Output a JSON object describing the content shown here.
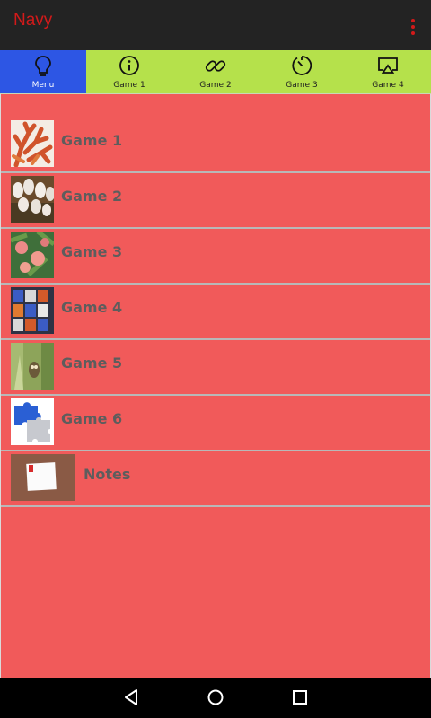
{
  "app": {
    "title": "Navy"
  },
  "tabs": [
    {
      "label": "Menu",
      "icon": "lightbulb-icon",
      "active": true
    },
    {
      "label": "Game 1",
      "icon": "info-icon",
      "active": false
    },
    {
      "label": "Game 2",
      "icon": "link-icon",
      "active": false
    },
    {
      "label": "Game 3",
      "icon": "timer-icon",
      "active": false
    },
    {
      "label": "Game 4",
      "icon": "cast-icon",
      "active": false
    }
  ],
  "list": [
    {
      "label": "Game 1",
      "thumb": "coral-photo"
    },
    {
      "label": "Game 2",
      "thumb": "flowers-photo"
    },
    {
      "label": "Game 3",
      "thumb": "peaches-photo"
    },
    {
      "label": "Game 4",
      "thumb": "cube-photo"
    },
    {
      "label": "Game 5",
      "thumb": "owl-photo"
    },
    {
      "label": "Game 6",
      "thumb": "puzzle-photo"
    },
    {
      "label": "Notes",
      "thumb": "notepad-photo"
    }
  ],
  "colors": {
    "appbar": "#232323",
    "title": "#d21a1a",
    "tab_bar": "#b5e14b",
    "tab_active": "#2d56e4",
    "content_bg": "#f15a5a",
    "divider": "#b8b8b8",
    "row_text": "#5d5d5d"
  },
  "system_nav": [
    "back-icon",
    "home-icon",
    "recents-icon"
  ]
}
